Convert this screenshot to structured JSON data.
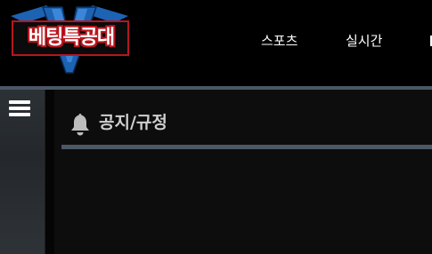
{
  "brand": {
    "logo_text": "베팅특공대",
    "colors": {
      "blue": "#1d63b4",
      "red": "#b8161e",
      "divider": "#4b5866"
    }
  },
  "nav": {
    "items": [
      {
        "label": "스포츠"
      },
      {
        "label": "실시간"
      }
    ]
  },
  "sidebar": {
    "menu_icon": "hamburger-menu-icon"
  },
  "content": {
    "section_icon": "bell-icon",
    "section_title": "공지/규정"
  }
}
